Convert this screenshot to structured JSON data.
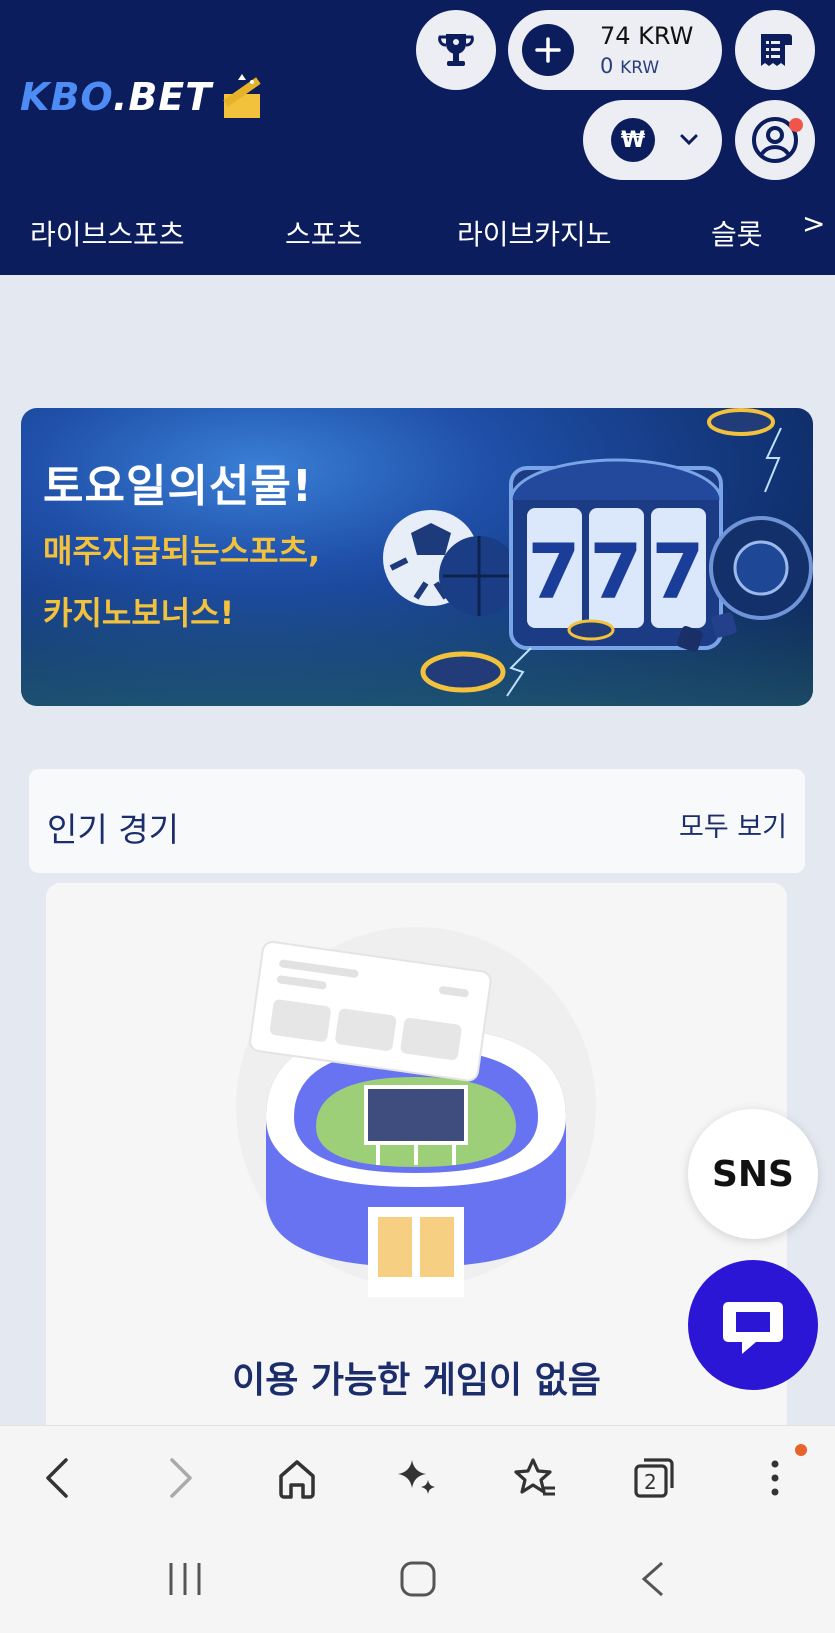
{
  "header": {
    "logo_kbo": "KBO",
    "logo_bet": ".BET",
    "balance_main": "74 KRW",
    "balance_sub_amount": "0",
    "balance_sub_currency": "KRW",
    "currency_symbol": "₩"
  },
  "nav": {
    "items": [
      "라이브스포츠",
      "스포츠",
      "라이브카지노",
      "슬롯"
    ],
    "more": ">"
  },
  "banner": {
    "title": "토요일의선물!",
    "line2": "매주지급되는스포츠,",
    "line3": "카지노보너스!",
    "slot_digits": [
      "7",
      "7",
      "7"
    ]
  },
  "popular": {
    "title": "인기 경기",
    "view_all": "모두 보기",
    "empty_message": "이용 가능한 게임이 없음"
  },
  "floating": {
    "sns_label": "SNS"
  },
  "browser": {
    "tabs_count": "2"
  },
  "colors": {
    "header_bg": "#0b1d5c",
    "accent_blue": "#4d8cf5",
    "banner_yellow": "#f3c23d",
    "chat_button": "#2b16d6",
    "notification": "#f0554a"
  }
}
